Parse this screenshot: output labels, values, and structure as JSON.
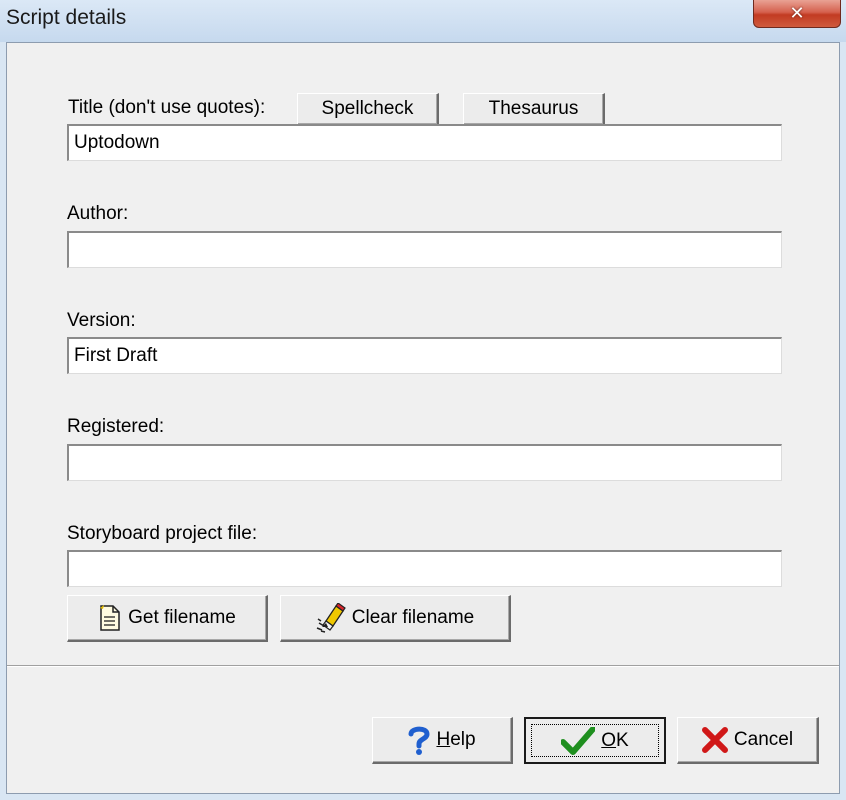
{
  "window": {
    "title": "Script details",
    "close_glyph": "✕"
  },
  "form": {
    "title_label": "Title (don't use quotes):",
    "title_value": "Uptodown",
    "spellcheck_label": "Spellcheck",
    "thesaurus_label": "Thesaurus",
    "author_label": "Author:",
    "author_value": "",
    "version_label": "Version:",
    "version_value": "First Draft",
    "registered_label": "Registered:",
    "registered_value": "",
    "storyboard_label": "Storyboard project file:",
    "storyboard_value": "",
    "get_filename_label": "Get filename",
    "clear_filename_label": "Clear filename"
  },
  "footer": {
    "help_label_mnemonic": "H",
    "help_label_rest": "elp",
    "ok_label_mnemonic": "O",
    "ok_label_rest": "K",
    "cancel_label": "Cancel"
  },
  "icons": {
    "get_filename": "document-icon",
    "clear_filename": "eraser-icon",
    "help": "question-mark-icon",
    "ok": "checkmark-icon",
    "cancel": "red-x-icon"
  },
  "colors": {
    "help_icon": "#1f5fcf",
    "ok_icon": "#1f8f1f",
    "cancel_icon": "#d01818",
    "close_button": "#c23b22"
  }
}
